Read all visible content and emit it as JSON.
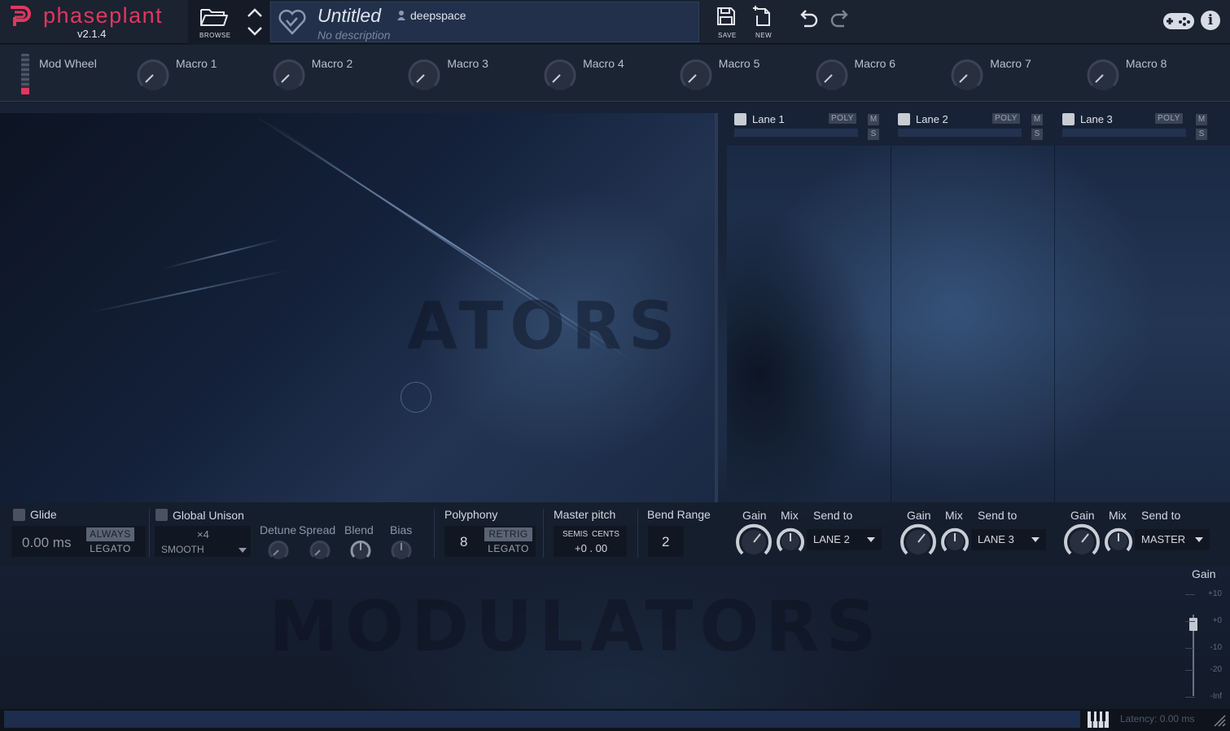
{
  "app": {
    "name": "phaseplant",
    "version": "v2.1.4",
    "accent_color": "#e0375f"
  },
  "toolbar": {
    "browse_label": "BROWSE",
    "save_label": "SAVE",
    "new_label": "NEW",
    "icons": [
      "folder-icon",
      "chevron-up-icon",
      "chevron-down-icon",
      "heart-icon",
      "save-icon",
      "new-file-icon",
      "undo-icon",
      "redo-icon",
      "gamepad-icon",
      "info-icon"
    ]
  },
  "preset": {
    "title": "Untitled",
    "author": "deepspace",
    "description": "No description"
  },
  "macros": {
    "mod_wheel_label": "Mod Wheel",
    "labels": [
      "Macro 1",
      "Macro 2",
      "Macro 3",
      "Macro 4",
      "Macro 5",
      "Macro 6",
      "Macro 7",
      "Macro 8"
    ]
  },
  "lanes": [
    {
      "name": "Lane 1",
      "poly": "POLY",
      "mute": "M",
      "solo": "S",
      "enabled": true,
      "send_to": "LANE 2",
      "gain_label": "Gain",
      "mix_label": "Mix",
      "send_label": "Send to"
    },
    {
      "name": "Lane 2",
      "poly": "POLY",
      "mute": "M",
      "solo": "S",
      "enabled": true,
      "send_to": "LANE 3",
      "gain_label": "Gain",
      "mix_label": "Mix",
      "send_label": "Send to"
    },
    {
      "name": "Lane 3",
      "poly": "POLY",
      "mute": "M",
      "solo": "S",
      "enabled": true,
      "send_to": "MASTER",
      "gain_label": "Gain",
      "mix_label": "Mix",
      "send_label": "Send to"
    }
  ],
  "glide": {
    "label": "Glide",
    "value": "0.00 ms",
    "mode_on": "ALWAYS",
    "mode_off": "LEGATO"
  },
  "unison": {
    "label": "Global Unison",
    "voices": "×4",
    "mode": "SMOOTH",
    "knob_labels": [
      "Detune",
      "Spread",
      "Blend",
      "Bias"
    ]
  },
  "polyphony": {
    "label": "Polyphony",
    "value": "8",
    "mode_on": "RETRIG",
    "mode_off": "LEGATO"
  },
  "master_pitch": {
    "label": "Master pitch",
    "semis_label": "SEMIS",
    "cents_label": "CENTS",
    "value": "+0 . 00"
  },
  "bend_range": {
    "label": "Bend Range",
    "value": "2"
  },
  "master_gain": {
    "label": "Gain",
    "ticks": [
      "+10",
      "+0",
      "-10",
      "-20",
      "-Inf"
    ],
    "value_db": 0
  },
  "status": {
    "latency": "Latency: 0.00 ms"
  },
  "watermarks": {
    "left": "ATORS",
    "bottom": "MODULATORS"
  }
}
